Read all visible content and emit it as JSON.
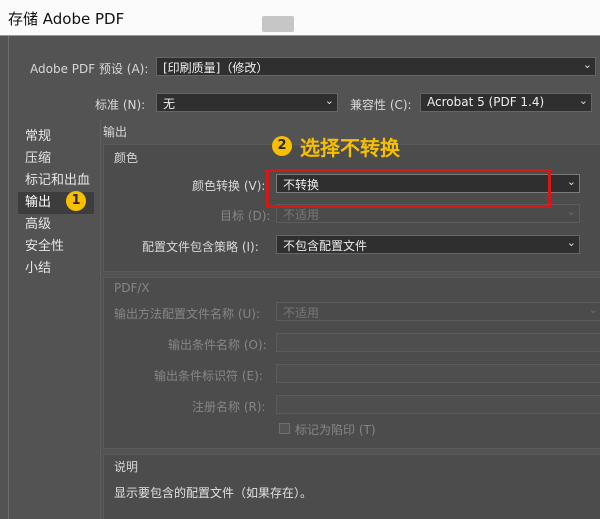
{
  "window": {
    "title": "存储 Adobe PDF"
  },
  "preset": {
    "label": "Adobe PDF 预设 (A):",
    "value": "[印刷质量]（修改）"
  },
  "standard": {
    "label": "标准 (N):",
    "value": "无"
  },
  "compat": {
    "label": "兼容性 (C):",
    "value": "Acrobat 5 (PDF 1.4)"
  },
  "sidebar": {
    "items": [
      {
        "label": "常规"
      },
      {
        "label": "压缩"
      },
      {
        "label": "标记和出血"
      },
      {
        "label": "输出"
      },
      {
        "label": "高级"
      },
      {
        "label": "安全性"
      },
      {
        "label": "小结"
      }
    ]
  },
  "output": {
    "section_title": "输出",
    "color": {
      "group_title": "颜色",
      "conversion_label": "颜色转换 (V):",
      "conversion_value": "不转换",
      "target_label": "目标 (D):",
      "target_value": "不适用",
      "policy_label": "配置文件包含策略 (I):",
      "policy_value": "不包含配置文件"
    },
    "pdfx": {
      "group_title": "PDF/X",
      "profile_name_label": "输出方法配置文件名称 (U):",
      "profile_name_value": "不适用",
      "condition_name_label": "输出条件名称 (O):",
      "condition_id_label": "输出条件标识符 (E):",
      "registry_label": "注册名称 (R):",
      "trapped_label": "标记为陷印 (T)"
    },
    "description": {
      "title": "说明",
      "text": "显示要包含的配置文件（如果存在）。"
    }
  },
  "annotations": {
    "step1": "1",
    "step2": "2",
    "step2_text": "选择不转换",
    "color": "#f6bf00",
    "highlight_color": "#d41818"
  }
}
